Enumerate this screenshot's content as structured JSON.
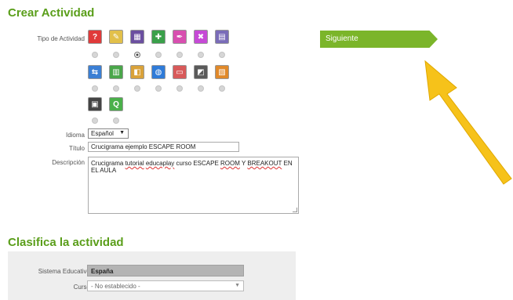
{
  "headings": {
    "crear": "Crear Actividad",
    "clasifica": "Clasifica la actividad"
  },
  "form": {
    "tipo_label": "Tipo de Actividad",
    "idioma_label": "Idioma",
    "idioma_value": "Español",
    "titulo_label": "Título",
    "titulo_value": "Crucigrama ejemplo ESCAPE ROOM",
    "descripcion_label": "Descripción",
    "descripcion_parts": [
      "Crucigrama ",
      "tutorial",
      " ",
      "educaplay",
      " curso ESCAPE ",
      "ROOM",
      " Y ",
      "BREAKOUT",
      " EN EL AULA"
    ]
  },
  "activity_types": {
    "selected_index": 2,
    "rows": [
      [
        {
          "icon": "question-quiz-icon",
          "glyph": "?",
          "color": "#e03a3a"
        },
        {
          "icon": "pencil-paper-icon",
          "glyph": "✎",
          "color": "#e2c04a"
        },
        {
          "icon": "crossword-grid-icon",
          "glyph": "▦",
          "color": "#6b4fa0"
        },
        {
          "icon": "map-puzzle-icon",
          "glyph": "✚",
          "color": "#3aa04a"
        },
        {
          "icon": "feather-pen-icon",
          "glyph": "✒",
          "color": "#d84fb0"
        },
        {
          "icon": "shuffle-cards-icon",
          "glyph": "✖",
          "color": "#c64ad6"
        },
        {
          "icon": "word-search-icon",
          "glyph": "▤",
          "color": "#7a6cb8"
        }
      ],
      [
        {
          "icon": "matching-columns-icon",
          "glyph": "⇆",
          "color": "#3b7fd4"
        },
        {
          "icon": "grid-game-icon",
          "glyph": "▥",
          "color": "#4aa64a"
        },
        {
          "icon": "puzzle-pieces-icon",
          "glyph": "◧",
          "color": "#d9a23a"
        },
        {
          "icon": "world-map-icon",
          "glyph": "◍",
          "color": "#2f7bd8"
        },
        {
          "icon": "presentation-board-icon",
          "glyph": "▭",
          "color": "#d85a5a"
        },
        {
          "icon": "video-clapper-icon",
          "glyph": "◩",
          "color": "#5a5a5a"
        },
        {
          "icon": "sorting-blocks-icon",
          "glyph": "▧",
          "color": "#e0892a"
        }
      ],
      [
        {
          "icon": "slideshow-icon",
          "glyph": "▣",
          "color": "#444444"
        },
        {
          "icon": "quiz-badge-icon",
          "glyph": "Q",
          "color": "#4ab04a"
        }
      ]
    ]
  },
  "buttons": {
    "siguiente": "Siguiente"
  },
  "clasifica": {
    "sistema_label": "Sistema Educativo",
    "sistema_value": "España",
    "curso_label": "Curso",
    "curso_value": "- No establecido -"
  },
  "colors": {
    "accent_green": "#7bb52a",
    "heading_green": "#5a9e1a",
    "arrow_yellow": "#f6c21a"
  }
}
